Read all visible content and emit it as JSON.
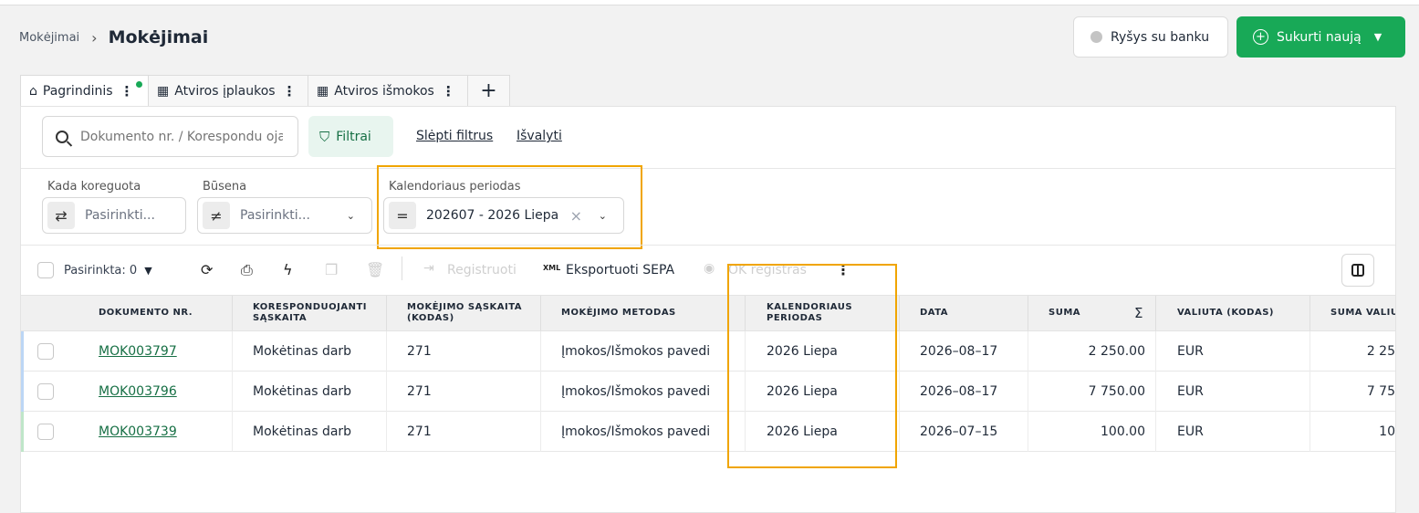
{
  "breadcrumb": {
    "parent": "Mokėjimai",
    "title": "Mokėjimai"
  },
  "header": {
    "bank_button": "Ryšys su banku",
    "create_button": "Sukurti naują"
  },
  "tabs": [
    {
      "label": "Pagrindinis",
      "icon": "home-icon"
    },
    {
      "label": "Atviros įplaukos",
      "icon": "table-icon"
    },
    {
      "label": "Atviros išmokos",
      "icon": "table-icon"
    }
  ],
  "search": {
    "placeholder": "Dokumento nr. / Korespondu ojantis"
  },
  "filters": {
    "filter_button": "Filtrai",
    "hide_link": "Slėpti filtrus",
    "clear_link": "Išvalyti",
    "modified": {
      "label": "Kada koreguota",
      "operator": "⇄",
      "value": "Pasirinkti..."
    },
    "status": {
      "label": "Būsena",
      "operator": "≠",
      "value": "Pasirinkti..."
    },
    "calendar": {
      "label": "Kalendoriaus periodas",
      "operator": "=",
      "value": "202607 - 2026 Liepa"
    }
  },
  "toolbar": {
    "selected": "Pasirinkta: 0",
    "register": "Registruoti",
    "export": "Eksportuoti SEPA",
    "export_icon": "XML",
    "ok_register": "OK registras"
  },
  "table": {
    "headers": {
      "doc": "DOKUMENTO NR.",
      "corr": "KORESPONDUOJANTI SĄSKAITA",
      "acc": "MOKĖJIMO SĄSKAITA (KODAS)",
      "method": "MOKĖJIMO METODAS",
      "period": "KALENDORIAUS PERIODAS",
      "date": "DATA",
      "sum": "SUMA",
      "sum_icon": "Σ",
      "currency": "VALIUTA (KODAS)",
      "sum_cur": "SUMA VALIU"
    },
    "rows": [
      {
        "doc": "MOK003797",
        "corr": "Mokėtinas darb",
        "acc": "271",
        "method": "Įmokos/Išmokos pavedi",
        "period": "2026 Liepa",
        "date": "2026–08–17",
        "sum": "2 250.00",
        "currency": "EUR",
        "sum_cur": "2 25"
      },
      {
        "doc": "MOK003796",
        "corr": "Mokėtinas darb",
        "acc": "271",
        "method": "Įmokos/Išmokos pavedi",
        "period": "2026 Liepa",
        "date": "2026–08–17",
        "sum": "7 750.00",
        "currency": "EUR",
        "sum_cur": "7 75"
      },
      {
        "doc": "MOK003739",
        "corr": "Mokėtinas darb",
        "acc": "271",
        "method": "Įmokos/Išmokos pavedi",
        "period": "2026 Liepa",
        "date": "2026–07–15",
        "sum": "100.00",
        "currency": "EUR",
        "sum_cur": "10"
      }
    ]
  },
  "colors": {
    "accent": "#18a957",
    "highlight": "#f0a500",
    "row_bar_blue": "#bcd6f5",
    "row_bar_green": "#bfe6c9"
  }
}
